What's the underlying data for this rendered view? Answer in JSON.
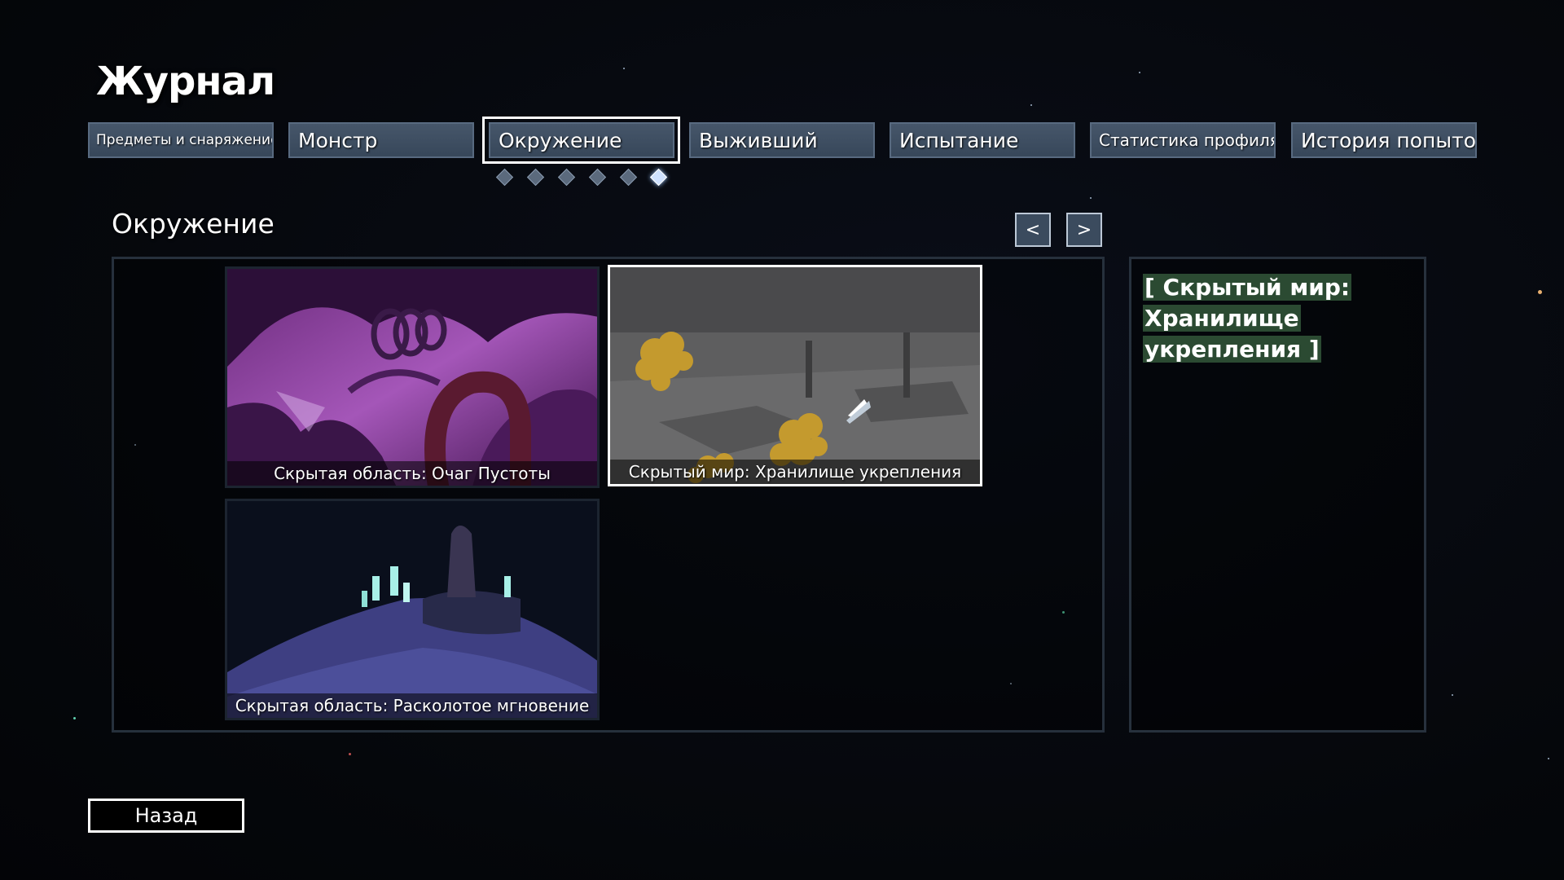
{
  "header": {
    "title": "Журнал"
  },
  "tabs": [
    {
      "label": "Предметы и снаряжение",
      "active": false
    },
    {
      "label": "Монстр",
      "active": false
    },
    {
      "label": "Окружение",
      "active": true
    },
    {
      "label": "Выживший",
      "active": false
    },
    {
      "label": "Испытание",
      "active": false
    },
    {
      "label": "Статистика профиля",
      "active": false
    },
    {
      "label": "История попыток",
      "active": false
    }
  ],
  "pager": {
    "pages": 6,
    "current": 6
  },
  "section": {
    "title": "Окружение",
    "prev_label": "<",
    "next_label": ">"
  },
  "cards": [
    {
      "caption": "Скрытая область: Очаг Пустоты",
      "selected": false
    },
    {
      "caption": "Скрытый мир: Хранилище укрепления",
      "selected": true
    },
    {
      "caption": "Скрытая область: Расколотое мгновение",
      "selected": false
    }
  ],
  "detail": {
    "title": "[ Скрытый мир: Хранилище укрепления ]"
  },
  "footer": {
    "back_label": "Назад"
  },
  "colors": {
    "tab_bg": "#3f4f63",
    "highlight": "#2b4a32",
    "selected_border": "#ffffff",
    "background": "#05070c"
  }
}
